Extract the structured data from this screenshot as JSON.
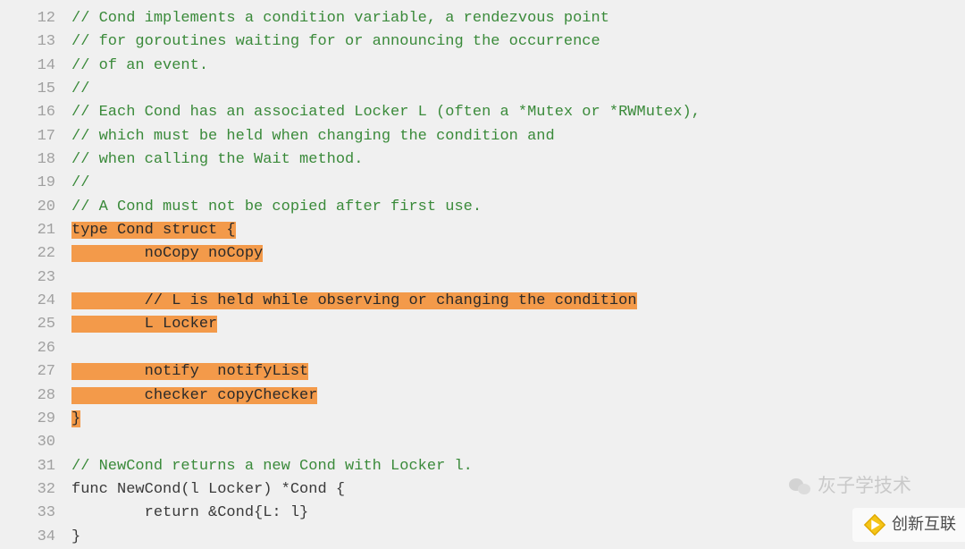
{
  "lines": [
    {
      "num": "12",
      "segs": [
        {
          "text": "// Cond implements a condition variable, a rendezvous point",
          "cls": "comment"
        }
      ]
    },
    {
      "num": "13",
      "segs": [
        {
          "text": "// for goroutines waiting for or announcing the occurrence",
          "cls": "comment"
        }
      ]
    },
    {
      "num": "14",
      "segs": [
        {
          "text": "// of an event.",
          "cls": "comment"
        }
      ]
    },
    {
      "num": "15",
      "segs": [
        {
          "text": "//",
          "cls": "comment"
        }
      ]
    },
    {
      "num": "16",
      "segs": [
        {
          "text": "// Each Cond has an associated Locker L (often a *Mutex or *RWMutex),",
          "cls": "comment"
        }
      ]
    },
    {
      "num": "17",
      "segs": [
        {
          "text": "// which must be held when changing the condition and",
          "cls": "comment"
        }
      ]
    },
    {
      "num": "18",
      "segs": [
        {
          "text": "// when calling the Wait method.",
          "cls": "comment"
        }
      ]
    },
    {
      "num": "19",
      "segs": [
        {
          "text": "//",
          "cls": "comment"
        }
      ]
    },
    {
      "num": "20",
      "segs": [
        {
          "text": "// A Cond must not be copied after first use.",
          "cls": "comment"
        }
      ]
    },
    {
      "num": "21",
      "segs": [
        {
          "text": "type Cond struct {",
          "cls": "highlight"
        }
      ]
    },
    {
      "num": "22",
      "segs": [
        {
          "text": "        ",
          "cls": "highlight-fill"
        },
        {
          "text": "noCopy noCopy",
          "cls": "highlight"
        }
      ]
    },
    {
      "num": "23",
      "segs": []
    },
    {
      "num": "24",
      "segs": [
        {
          "text": "        ",
          "cls": "highlight-fill"
        },
        {
          "text": "// L is held while observing or changing the condition",
          "cls": "highlight"
        }
      ]
    },
    {
      "num": "25",
      "segs": [
        {
          "text": "        ",
          "cls": "highlight-fill"
        },
        {
          "text": "L Locker",
          "cls": "highlight"
        }
      ]
    },
    {
      "num": "26",
      "segs": []
    },
    {
      "num": "27",
      "segs": [
        {
          "text": "        ",
          "cls": "highlight-fill"
        },
        {
          "text": "notify  notifyList",
          "cls": "highlight"
        }
      ]
    },
    {
      "num": "28",
      "segs": [
        {
          "text": "        ",
          "cls": "highlight-fill"
        },
        {
          "text": "checker copyChecker",
          "cls": "highlight"
        }
      ]
    },
    {
      "num": "29",
      "segs": [
        {
          "text": "}",
          "cls": "highlight"
        }
      ]
    },
    {
      "num": "30",
      "segs": []
    },
    {
      "num": "31",
      "segs": [
        {
          "text": "// NewCond returns a new Cond with Locker l.",
          "cls": "comment"
        }
      ]
    },
    {
      "num": "32",
      "segs": [
        {
          "text": "func NewCond(l Locker) *Cond {",
          "cls": "keyword"
        }
      ]
    },
    {
      "num": "33",
      "segs": [
        {
          "text": "        return &Cond{L: l}",
          "cls": "keyword"
        }
      ]
    },
    {
      "num": "34",
      "segs": [
        {
          "text": "}",
          "cls": "keyword"
        }
      ]
    }
  ],
  "watermark1": "灰子学技术",
  "watermark2": "创新互联"
}
